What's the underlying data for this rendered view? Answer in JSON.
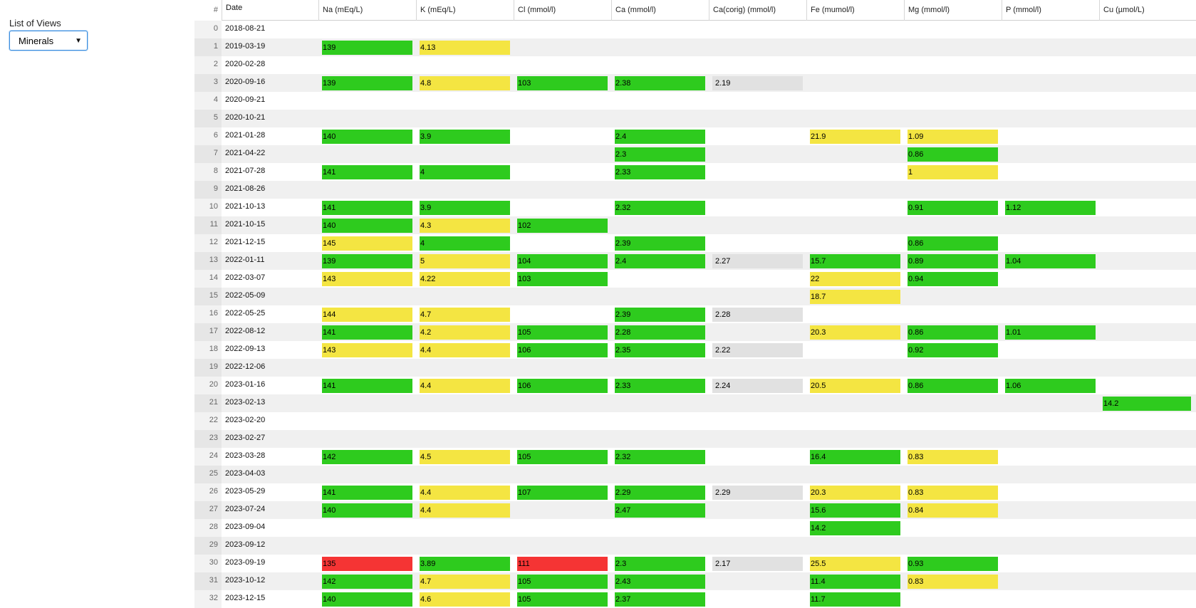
{
  "sidebar": {
    "label": "List of Views",
    "selected_view": "Minerals"
  },
  "colors": {
    "green": "#2ecb1e",
    "yellow": "#f4e542",
    "red": "#f53434",
    "gray": "#e1e1e1",
    "focus": "#3b8ee0"
  },
  "table": {
    "index_header": "#",
    "date_header": "Date",
    "columns": [
      "Na (mEq/L)",
      "K (mEq/L)",
      "Cl (mmol/l)",
      "Ca (mmol/l)",
      "Ca(corig) (mmol/l)",
      "Fe (mumol/l)",
      "Mg (mmol/l)",
      "P (mmol/l)",
      "Cu (µmol/L)"
    ],
    "rows": [
      {
        "i": "0",
        "date": "2018-08-21",
        "cells": [
          null,
          null,
          null,
          null,
          null,
          null,
          null,
          null,
          null
        ]
      },
      {
        "i": "1",
        "date": "2019-03-19",
        "cells": [
          {
            "v": "139",
            "c": "green"
          },
          {
            "v": "4.13",
            "c": "yellow"
          },
          null,
          null,
          null,
          null,
          null,
          null,
          null
        ]
      },
      {
        "i": "2",
        "date": "2020-02-28",
        "cells": [
          null,
          null,
          null,
          null,
          null,
          null,
          null,
          null,
          null
        ]
      },
      {
        "i": "3",
        "date": "2020-09-16",
        "cells": [
          {
            "v": "139",
            "c": "green"
          },
          {
            "v": "4.8",
            "c": "yellow"
          },
          {
            "v": "103",
            "c": "green"
          },
          {
            "v": "2.38",
            "c": "green"
          },
          {
            "v": "2.19",
            "c": "gray"
          },
          null,
          null,
          null,
          null
        ]
      },
      {
        "i": "4",
        "date": "2020-09-21",
        "cells": [
          null,
          null,
          null,
          null,
          null,
          null,
          null,
          null,
          null
        ]
      },
      {
        "i": "5",
        "date": "2020-10-21",
        "cells": [
          null,
          null,
          null,
          null,
          null,
          null,
          null,
          null,
          null
        ]
      },
      {
        "i": "6",
        "date": "2021-01-28",
        "cells": [
          {
            "v": "140",
            "c": "green"
          },
          {
            "v": "3.9",
            "c": "green"
          },
          null,
          {
            "v": "2.4",
            "c": "green"
          },
          null,
          {
            "v": "21.9",
            "c": "yellow"
          },
          {
            "v": "1.09",
            "c": "yellow"
          },
          null,
          null
        ]
      },
      {
        "i": "7",
        "date": "2021-04-22",
        "cells": [
          null,
          null,
          null,
          {
            "v": "2.3",
            "c": "green"
          },
          null,
          null,
          {
            "v": "0.86",
            "c": "green"
          },
          null,
          null
        ]
      },
      {
        "i": "8",
        "date": "2021-07-28",
        "cells": [
          {
            "v": "141",
            "c": "green"
          },
          {
            "v": "4",
            "c": "green"
          },
          null,
          {
            "v": "2.33",
            "c": "green"
          },
          null,
          null,
          {
            "v": "1",
            "c": "yellow"
          },
          null,
          null
        ]
      },
      {
        "i": "9",
        "date": "2021-08-26",
        "cells": [
          null,
          null,
          null,
          null,
          null,
          null,
          null,
          null,
          null
        ]
      },
      {
        "i": "10",
        "date": "2021-10-13",
        "cells": [
          {
            "v": "141",
            "c": "green"
          },
          {
            "v": "3.9",
            "c": "green"
          },
          null,
          {
            "v": "2.32",
            "c": "green"
          },
          null,
          null,
          {
            "v": "0.91",
            "c": "green"
          },
          {
            "v": "1.12",
            "c": "green"
          },
          null
        ]
      },
      {
        "i": "11",
        "date": "2021-10-15",
        "cells": [
          {
            "v": "140",
            "c": "green"
          },
          {
            "v": "4.3",
            "c": "yellow"
          },
          {
            "v": "102",
            "c": "green"
          },
          null,
          null,
          null,
          null,
          null,
          null
        ]
      },
      {
        "i": "12",
        "date": "2021-12-15",
        "cells": [
          {
            "v": "145",
            "c": "yellow"
          },
          {
            "v": "4",
            "c": "green"
          },
          null,
          {
            "v": "2.39",
            "c": "green"
          },
          null,
          null,
          {
            "v": "0.86",
            "c": "green"
          },
          null,
          null
        ]
      },
      {
        "i": "13",
        "date": "2022-01-11",
        "cells": [
          {
            "v": "139",
            "c": "green"
          },
          {
            "v": "5",
            "c": "yellow"
          },
          {
            "v": "104",
            "c": "green"
          },
          {
            "v": "2.4",
            "c": "green"
          },
          {
            "v": "2.27",
            "c": "gray"
          },
          {
            "v": "15.7",
            "c": "green"
          },
          {
            "v": "0.89",
            "c": "green"
          },
          {
            "v": "1.04",
            "c": "green"
          },
          null
        ]
      },
      {
        "i": "14",
        "date": "2022-03-07",
        "cells": [
          {
            "v": "143",
            "c": "yellow"
          },
          {
            "v": "4.22",
            "c": "yellow"
          },
          {
            "v": "103",
            "c": "green"
          },
          null,
          null,
          {
            "v": "22",
            "c": "yellow"
          },
          {
            "v": "0.94",
            "c": "green"
          },
          null,
          null
        ]
      },
      {
        "i": "15",
        "date": "2022-05-09",
        "cells": [
          null,
          null,
          null,
          null,
          null,
          {
            "v": "18.7",
            "c": "yellow"
          },
          null,
          null,
          null
        ]
      },
      {
        "i": "16",
        "date": "2022-05-25",
        "cells": [
          {
            "v": "144",
            "c": "yellow"
          },
          {
            "v": "4.7",
            "c": "yellow"
          },
          null,
          {
            "v": "2.39",
            "c": "green"
          },
          {
            "v": "2.28",
            "c": "gray"
          },
          null,
          null,
          null,
          null
        ]
      },
      {
        "i": "17",
        "date": "2022-08-12",
        "cells": [
          {
            "v": "141",
            "c": "green"
          },
          {
            "v": "4.2",
            "c": "yellow"
          },
          {
            "v": "105",
            "c": "green"
          },
          {
            "v": "2.28",
            "c": "green"
          },
          null,
          {
            "v": "20.3",
            "c": "yellow"
          },
          {
            "v": "0.86",
            "c": "green"
          },
          {
            "v": "1.01",
            "c": "green"
          },
          null
        ]
      },
      {
        "i": "18",
        "date": "2022-09-13",
        "cells": [
          {
            "v": "143",
            "c": "yellow"
          },
          {
            "v": "4.4",
            "c": "yellow"
          },
          {
            "v": "106",
            "c": "green"
          },
          {
            "v": "2.35",
            "c": "green"
          },
          {
            "v": "2.22",
            "c": "gray"
          },
          null,
          {
            "v": "0.92",
            "c": "green"
          },
          null,
          null
        ]
      },
      {
        "i": "19",
        "date": "2022-12-06",
        "cells": [
          null,
          null,
          null,
          null,
          null,
          null,
          null,
          null,
          null
        ]
      },
      {
        "i": "20",
        "date": "2023-01-16",
        "cells": [
          {
            "v": "141",
            "c": "green"
          },
          {
            "v": "4.4",
            "c": "yellow"
          },
          {
            "v": "106",
            "c": "green"
          },
          {
            "v": "2.33",
            "c": "green"
          },
          {
            "v": "2.24",
            "c": "gray"
          },
          {
            "v": "20.5",
            "c": "yellow"
          },
          {
            "v": "0.86",
            "c": "green"
          },
          {
            "v": "1.06",
            "c": "green"
          },
          null
        ]
      },
      {
        "i": "21",
        "date": "2023-02-13",
        "cells": [
          null,
          null,
          null,
          null,
          null,
          null,
          null,
          null,
          {
            "v": "14.2",
            "c": "green"
          }
        ]
      },
      {
        "i": "22",
        "date": "2023-02-20",
        "cells": [
          null,
          null,
          null,
          null,
          null,
          null,
          null,
          null,
          null
        ]
      },
      {
        "i": "23",
        "date": "2023-02-27",
        "cells": [
          null,
          null,
          null,
          null,
          null,
          null,
          null,
          null,
          null
        ]
      },
      {
        "i": "24",
        "date": "2023-03-28",
        "cells": [
          {
            "v": "142",
            "c": "green"
          },
          {
            "v": "4.5",
            "c": "yellow"
          },
          {
            "v": "105",
            "c": "green"
          },
          {
            "v": "2.32",
            "c": "green"
          },
          null,
          {
            "v": "16.4",
            "c": "green"
          },
          {
            "v": "0.83",
            "c": "yellow"
          },
          null,
          null
        ]
      },
      {
        "i": "25",
        "date": "2023-04-03",
        "cells": [
          null,
          null,
          null,
          null,
          null,
          null,
          null,
          null,
          null
        ]
      },
      {
        "i": "26",
        "date": "2023-05-29",
        "cells": [
          {
            "v": "141",
            "c": "green"
          },
          {
            "v": "4.4",
            "c": "yellow"
          },
          {
            "v": "107",
            "c": "green"
          },
          {
            "v": "2.29",
            "c": "green"
          },
          {
            "v": "2.29",
            "c": "gray"
          },
          {
            "v": "20.3",
            "c": "yellow"
          },
          {
            "v": "0.83",
            "c": "yellow"
          },
          null,
          null
        ]
      },
      {
        "i": "27",
        "date": "2023-07-24",
        "cells": [
          {
            "v": "140",
            "c": "green"
          },
          {
            "v": "4.4",
            "c": "yellow"
          },
          null,
          {
            "v": "2.47",
            "c": "green"
          },
          null,
          {
            "v": "15.6",
            "c": "green"
          },
          {
            "v": "0.84",
            "c": "yellow"
          },
          null,
          null
        ]
      },
      {
        "i": "28",
        "date": "2023-09-04",
        "cells": [
          null,
          null,
          null,
          null,
          null,
          {
            "v": "14.2",
            "c": "green"
          },
          null,
          null,
          null
        ]
      },
      {
        "i": "29",
        "date": "2023-09-12",
        "cells": [
          null,
          null,
          null,
          null,
          null,
          null,
          null,
          null,
          null
        ]
      },
      {
        "i": "30",
        "date": "2023-09-19",
        "cells": [
          {
            "v": "135",
            "c": "red"
          },
          {
            "v": "3.89",
            "c": "green"
          },
          {
            "v": "111",
            "c": "red"
          },
          {
            "v": "2.3",
            "c": "green"
          },
          {
            "v": "2.17",
            "c": "gray"
          },
          {
            "v": "25.5",
            "c": "yellow"
          },
          {
            "v": "0.93",
            "c": "green"
          },
          null,
          null
        ]
      },
      {
        "i": "31",
        "date": "2023-10-12",
        "cells": [
          {
            "v": "142",
            "c": "green"
          },
          {
            "v": "4.7",
            "c": "yellow"
          },
          {
            "v": "105",
            "c": "green"
          },
          {
            "v": "2.43",
            "c": "green"
          },
          null,
          {
            "v": "11.4",
            "c": "green"
          },
          {
            "v": "0.83",
            "c": "yellow"
          },
          null,
          null
        ]
      },
      {
        "i": "32",
        "date": "2023-12-15",
        "cells": [
          {
            "v": "140",
            "c": "green"
          },
          {
            "v": "4.6",
            "c": "yellow"
          },
          {
            "v": "105",
            "c": "green"
          },
          {
            "v": "2.37",
            "c": "green"
          },
          null,
          {
            "v": "11.7",
            "c": "green"
          },
          null,
          null,
          null
        ]
      }
    ]
  }
}
